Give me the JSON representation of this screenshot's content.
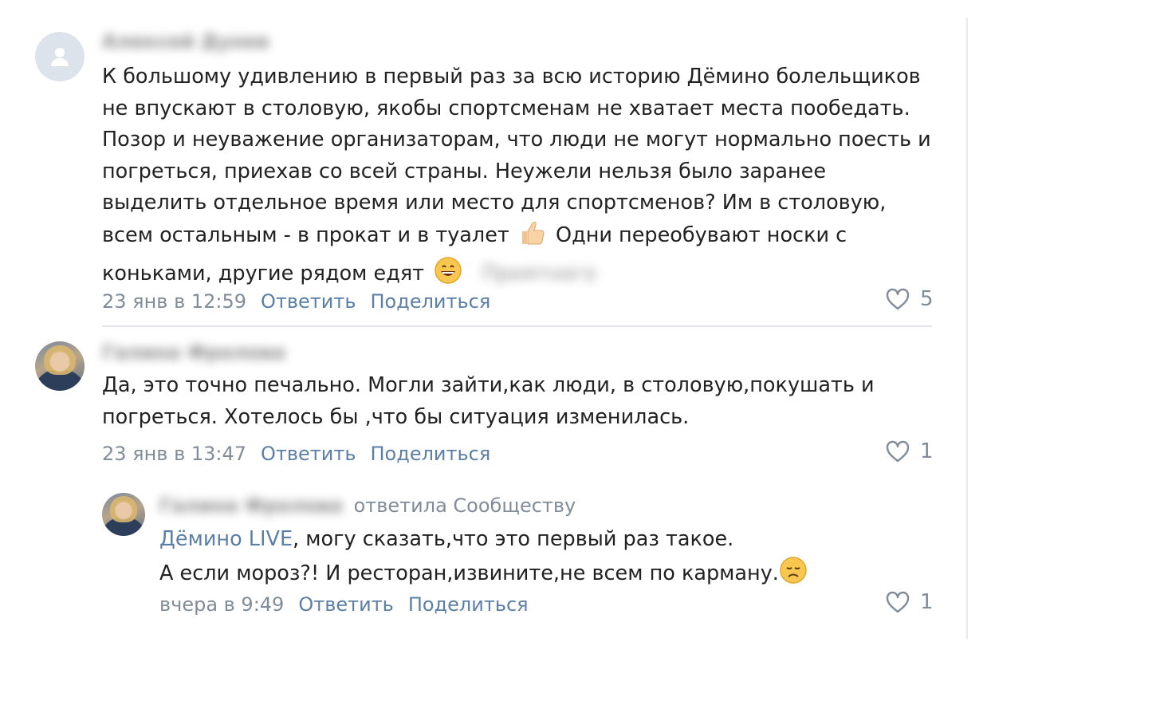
{
  "comments": [
    {
      "author": "Алексей Дунев",
      "lines": [
        "К большому удивлению в первый раз за всю историю Дёмино болельщиков",
        "не впускают в столовую, якобы спортсменам не хватает места пообедать.",
        "Позор и неуважение организаторам, что люди не могут нормально поесть и",
        "погреться, приехав со всей страны. Неужели нельзя было заранее",
        "выделить отдельное время или место для спортсменов? Им в столовую,",
        "всем остальным - в прокат и в туалет",
        "Одни переобувают носки с",
        "коньками, другие рядом едят",
        "Приятного"
      ],
      "date": "23 янв в 12:59",
      "reply_label": "Ответить",
      "share_label": "Поделиться",
      "likes": "5",
      "emojis": [
        "thumbs-up",
        "grinning-face"
      ]
    },
    {
      "author": "Галина Фролова",
      "lines": [
        "Да, это точно печально. Могли зайти,как люди, в столовую,покушать и",
        "погреться. Хотелось бы ,что бы ситуация изменилась."
      ],
      "date": "23 янв в 13:47",
      "reply_label": "Ответить",
      "share_label": "Поделиться",
      "likes": "1"
    }
  ],
  "reply": {
    "author": "Галина Фролова",
    "replied_to": "ответила Сообществу",
    "mention": "Дёмино LIVE",
    "line1_rest": ", могу сказать,что это первый раз такое.",
    "line2": "А если мороз?! И ресторан,извините,не всем по карману.",
    "date": "вчера в 9:49",
    "reply_label": "Ответить",
    "share_label": "Поделиться",
    "likes": "1",
    "emoji": "disappointed-face"
  },
  "colors": {
    "text": "#222222",
    "meta": "#818c99",
    "link": "#5b7fa6",
    "separator": "#e3e5e8"
  }
}
